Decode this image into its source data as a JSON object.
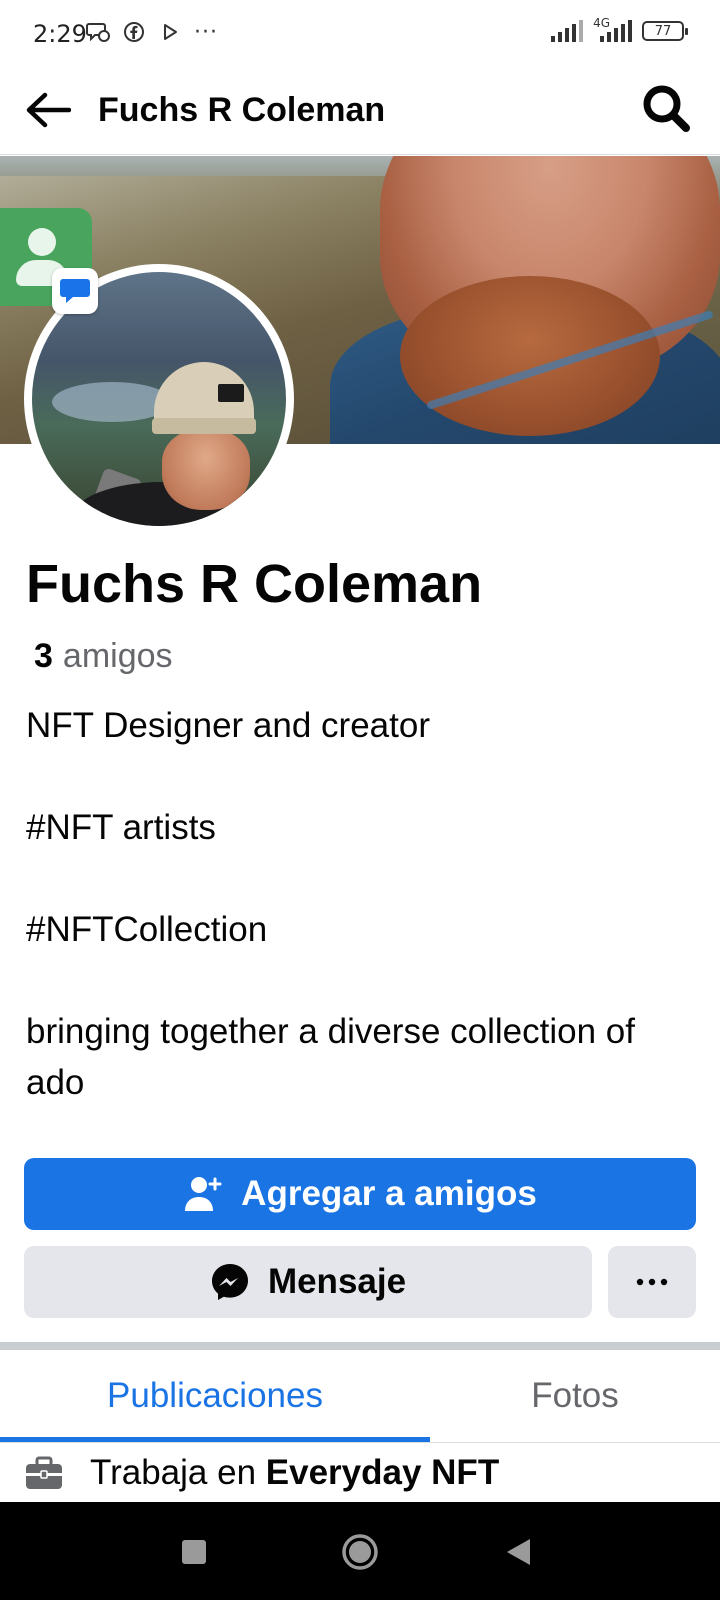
{
  "status_bar": {
    "time": "2:29",
    "network_label": "4G",
    "battery": "77",
    "more_indicator": "···"
  },
  "header": {
    "title": "Fuchs R Coleman"
  },
  "profile": {
    "name": "Fuchs R Coleman",
    "friends_count": "3",
    "friends_label": "amigos",
    "bio_lines": [
      "NFT Designer and creator",
      "#NFT artists",
      "#NFTCollection",
      "bringing together a diverse collection of ado"
    ]
  },
  "actions": {
    "add_friend_label": "Agregar a amigos",
    "message_label": "Mensaje",
    "more_label": "···"
  },
  "tabs": [
    {
      "label": "Publicaciones",
      "active": true
    },
    {
      "label": "Fotos",
      "active": false
    }
  ],
  "work": {
    "prefix": "Trabaja en",
    "company": "Everyday NFT"
  },
  "colors": {
    "accent": "#1b74e4",
    "secondary_button": "#e4e6eb",
    "muted_text": "#65676b"
  },
  "icons": [
    "back-arrow-icon",
    "search-icon",
    "add-friend-icon",
    "messenger-icon",
    "more-icon",
    "briefcase-icon",
    "contact-icon",
    "message-bubble-icon"
  ]
}
